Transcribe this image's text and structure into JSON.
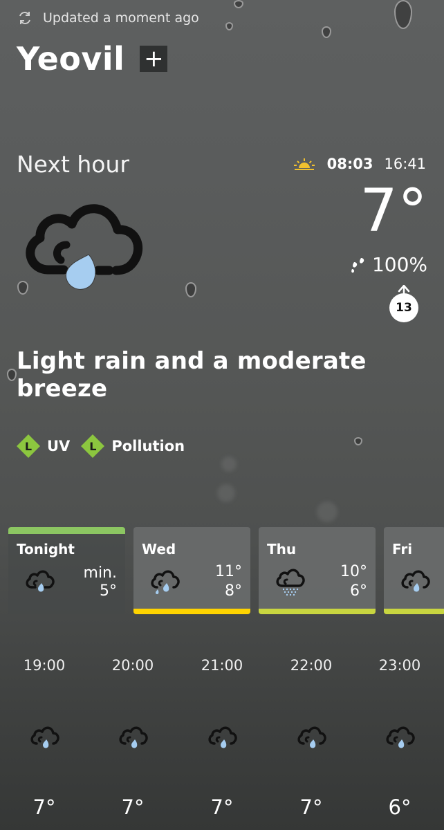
{
  "status": {
    "updated_text": "Updated a moment ago",
    "refresh_icon": "refresh-icon"
  },
  "location": {
    "name": "Yeovil",
    "add_label": "+"
  },
  "now": {
    "heading": "Next hour",
    "sunrise": "08:03",
    "sunset": "16:41",
    "temperature": "7°",
    "precip_chance": "100%",
    "wind_speed": "13",
    "description": "Light rain and a moderate breeze",
    "icon": "light-rain-cloud-icon"
  },
  "indices": [
    {
      "level": "L",
      "label": "UV"
    },
    {
      "level": "L",
      "label": "Pollution"
    }
  ],
  "days": [
    {
      "name": "Tonight",
      "hi": "min.",
      "lo": "5°",
      "bar_color": "#8cc662",
      "icon": "light-rain-cloud-icon"
    },
    {
      "name": "Wed",
      "hi": "11°",
      "lo": "8°",
      "bar_color": "#ffd400",
      "icon": "light-rain-cloud-icon"
    },
    {
      "name": "Thu",
      "hi": "10°",
      "lo": "6°",
      "bar_color": "#c9d640",
      "icon": "drizzle-cloud-icon"
    },
    {
      "name": "Fri",
      "hi": "",
      "lo": "",
      "bar_color": "#c9d640",
      "icon": "light-rain-cloud-icon"
    }
  ],
  "hours": [
    {
      "time": "19:00",
      "temp": "7°"
    },
    {
      "time": "20:00",
      "temp": "7°"
    },
    {
      "time": "21:00",
      "temp": "7°"
    },
    {
      "time": "22:00",
      "temp": "7°"
    },
    {
      "time": "23:00",
      "temp": "6°"
    }
  ],
  "colors": {
    "accent_green": "#8cc63f",
    "rain_blue": "#a6cdf0",
    "sun_yellow": "#f2c12e"
  }
}
